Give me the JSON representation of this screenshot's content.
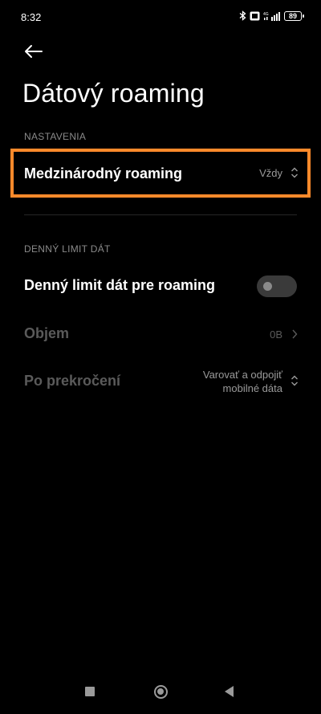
{
  "status_bar": {
    "time": "8:32",
    "battery": "89",
    "network_label": "4G"
  },
  "header": {
    "title": "Dátový roaming"
  },
  "sections": {
    "settings_header": "NASTAVENIA",
    "daily_limit_header": "DENNÝ LIMIT DÁT"
  },
  "rows": {
    "international_roaming": {
      "label": "Medzinárodný roaming",
      "value": "Vždy"
    },
    "daily_limit_roaming": {
      "label": "Denný limit dát pre roaming",
      "toggle_on": false
    },
    "volume": {
      "label": "Objem",
      "value": "0B"
    },
    "after_exceeding": {
      "label": "Po prekročení",
      "value_line1": "Varovať a odpojiť",
      "value_line2": "mobilné dáta"
    }
  },
  "colors": {
    "highlight": "#ff8a2b",
    "background": "#000000"
  }
}
